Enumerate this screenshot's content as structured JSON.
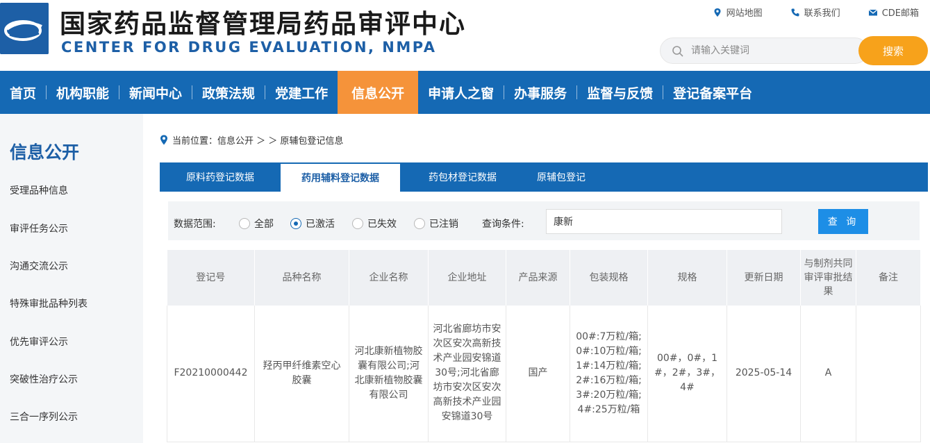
{
  "header": {
    "title_cn": "国家药品监督管理局药品审评中心",
    "title_en": "CENTER FOR DRUG EVALUATION, NMPA",
    "toplinks": [
      {
        "label": "网站地图",
        "icon": "map-pin-icon"
      },
      {
        "label": "联系我们",
        "icon": "phone-icon"
      },
      {
        "label": "CDE邮箱",
        "icon": "mail-icon"
      }
    ],
    "search_placeholder": "请输入关键词",
    "search_button": "搜索"
  },
  "nav": {
    "items": [
      "首页",
      "机构职能",
      "新闻中心",
      "政策法规",
      "党建工作",
      "信息公开",
      "申请人之窗",
      "办事服务",
      "监督与反馈",
      "登记备案平台"
    ],
    "active": "信息公开"
  },
  "sidebar": {
    "title": "信息公开",
    "items": [
      "受理品种信息",
      "审评任务公示",
      "沟通交流公示",
      "特殊审批品种列表",
      "优先审评公示",
      "突破性治疗公示",
      "三合一序列公示"
    ]
  },
  "breadcrumb": {
    "prefix": "当前位置：信息公开 ＞ ＞ 原辅包登记信息"
  },
  "tabs": {
    "items": [
      "原料药登记数据",
      "药用辅料登记数据",
      "药包材登记数据",
      "原辅包登记"
    ],
    "active": "药用辅料登记数据"
  },
  "filter": {
    "scope_label": "数据范围:",
    "options": [
      "全部",
      "已激活",
      "已失效",
      "已注销"
    ],
    "selected": "已激活",
    "query_label": "查询条件:",
    "query_value": "康新",
    "query_button": "查 询"
  },
  "table": {
    "headers": [
      "登记号",
      "品种名称",
      "企业名称",
      "企业地址",
      "产品来源",
      "包装规格",
      "规格",
      "更新日期",
      "与制剂共同审评审批结果",
      "备注"
    ],
    "rows": [
      {
        "reg_no": "F20210000442",
        "name": "羟丙甲纤维素空心胶囊",
        "company": "河北康新植物胶囊有限公司;河北康新植物胶囊有限公司",
        "address": "河北省廊坊市安次区安次高新技术产业园安锦道30号;河北省廊坊市安次区安次高新技术产业园安锦道30号",
        "source": "国产",
        "package": "00#:7万粒/箱;0#:10万粒/箱;1#:14万粒/箱;2#:16万粒/箱;3#:20万粒/箱;4#:25万粒/箱",
        "spec": "00#，0#，1#，2#，3#，4#",
        "date": "2025-05-14",
        "result": "A",
        "remark": ""
      }
    ]
  }
}
